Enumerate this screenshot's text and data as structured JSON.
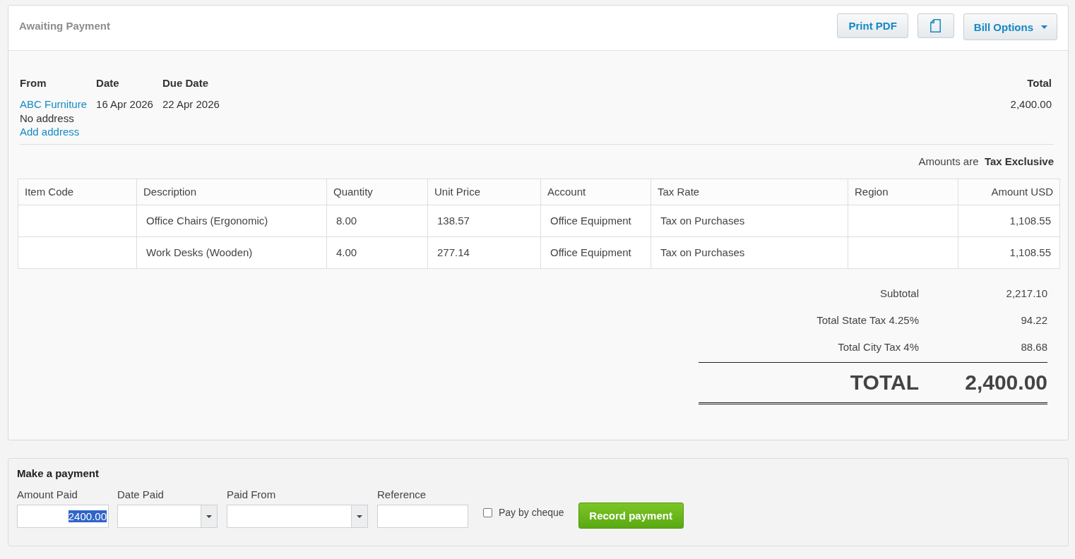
{
  "header": {
    "status": "Awaiting Payment",
    "buttons": [
      {
        "kind": "print",
        "label": "Print PDF"
      },
      {
        "kind": "document"
      },
      {
        "kind": "menu",
        "label": "Bill Options"
      }
    ]
  },
  "bill": {
    "fields": [
      {
        "heading": "From",
        "lines": [
          {
            "kind": "link",
            "text": "ABC Furniture"
          },
          {
            "kind": "text",
            "text": "No address"
          },
          {
            "kind": "link",
            "text": "Add address"
          }
        ]
      },
      {
        "heading": "Date",
        "lines": [
          {
            "kind": "text",
            "text": "16 Apr 2026"
          }
        ]
      },
      {
        "heading": "Due Date",
        "lines": [
          {
            "kind": "text",
            "text": "22 Apr 2026"
          }
        ]
      }
    ],
    "total": {
      "heading": "Total",
      "value": "2,400.00"
    },
    "tax_note": "Amounts are  **Tax Exclusive**"
  },
  "table": {
    "columns": [
      "Item Code",
      "Description",
      "Quantity",
      "Unit Price",
      "Account",
      "Tax Rate",
      "Region",
      "Amount USD"
    ],
    "rows": [
      {
        "description": "Office Chairs (Ergonomic)",
        "quantity": "8.00",
        "unit_price": "138.57",
        "account": "Office Equipment",
        "tax_rate": "Tax on Purchases",
        "amount": "1,108.55"
      },
      {
        "description": "Work Desks (Wooden)",
        "quantity": "4.00",
        "unit_price": "277.14",
        "account": "Office Equipment",
        "tax_rate": "Tax on Purchases",
        "amount": "1,108.55"
      }
    ]
  },
  "summary": {
    "lines": [
      {
        "label": "Subtotal",
        "value": "2,217.10"
      },
      {
        "label": "Total State Tax 4.25%",
        "value": "94.22"
      },
      {
        "label": "Total City Tax 4%",
        "value": "88.68"
      }
    ],
    "total": {
      "label": "TOTAL",
      "value": "2,400.00"
    }
  },
  "payment": {
    "title": "Make a payment",
    "fields": [
      {
        "kind": "input",
        "label": "Amount Paid",
        "value": "2400.00",
        "value_selected": true
      },
      {
        "kind": "select",
        "label": "Date Paid"
      },
      {
        "kind": "select",
        "label": "Paid From"
      },
      {
        "kind": "input",
        "label": "Reference"
      }
    ],
    "cheque": {
      "label": "Pay by cheque",
      "checked": false
    },
    "button": "Record payment"
  }
}
